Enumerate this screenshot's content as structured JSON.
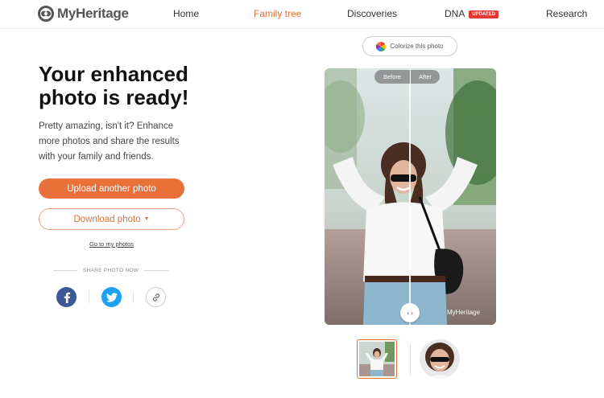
{
  "nav": {
    "logo_text": "MyHeritage",
    "items": [
      {
        "label": "Home"
      },
      {
        "label": "Family tree"
      },
      {
        "label": "Discoveries"
      },
      {
        "label": "DNA",
        "badge": "UPDATED"
      },
      {
        "label": "Research"
      }
    ]
  },
  "main": {
    "headline": "Your enhanced photo is ready!",
    "subtext": "Pretty amazing, isn't it? Enhance more photos and share the results with your family and friends.",
    "upload_label": "Upload another photo",
    "download_label": "Download photo",
    "my_photos_link": "Go to my photos",
    "share_label": "SHARE PHOTO NOW"
  },
  "viewer": {
    "colorize_label": "Colorize this photo",
    "before_label": "Before",
    "after_label": "After",
    "handle_glyph": "‹ ›",
    "watermark": "MyHeritage"
  },
  "colors": {
    "accent": "#e8713a",
    "facebook": "#3b5998",
    "twitter": "#1da1f2",
    "badge": "#e53935"
  },
  "icons": [
    "myheritage-logo-icon",
    "facebook-icon",
    "twitter-icon",
    "link-icon",
    "color-wheel-icon",
    "compare-arrows-icon",
    "dropdown-caret-icon"
  ]
}
